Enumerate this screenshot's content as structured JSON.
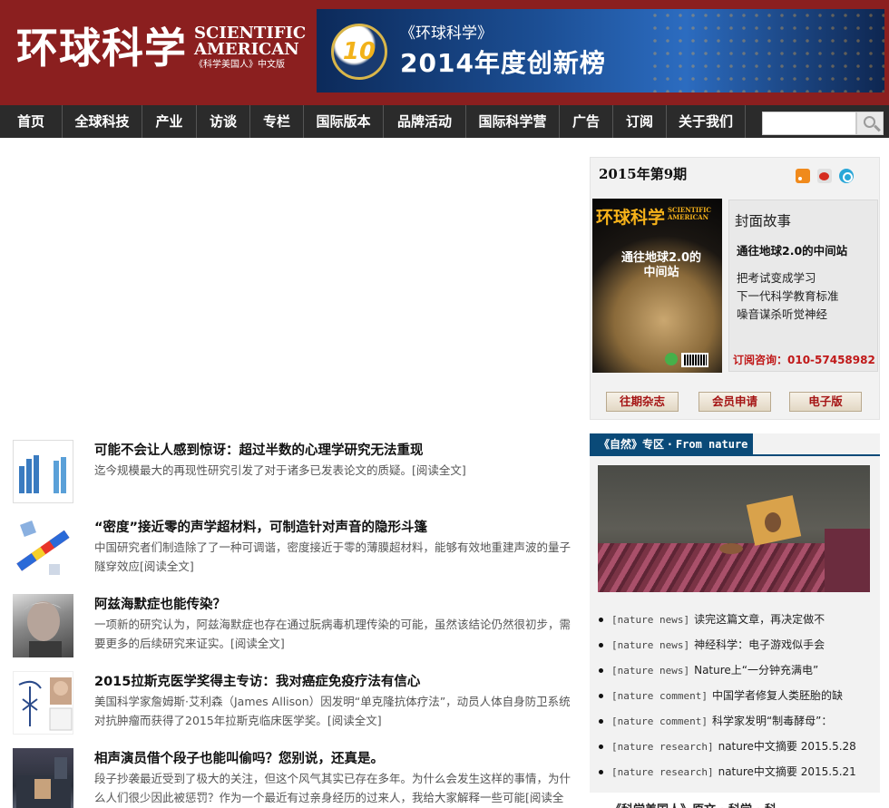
{
  "header": {
    "logo_cn": "环球科学",
    "logo_en_line1": "SCIENTIFIC",
    "logo_en_line2": "AMERICAN",
    "logo_sub": "《科学美国人》中文版",
    "banner": {
      "badge_number": "10",
      "line1": "《环球科学》",
      "line2": "2014年度创新榜"
    }
  },
  "nav": {
    "items": [
      "首页",
      "全球科技",
      "产业",
      "访谈",
      "专栏",
      "国际版本",
      "品牌活动",
      "国际科学营",
      "广告",
      "订阅",
      "关于我们"
    ],
    "search_placeholder": ""
  },
  "articles": [
    {
      "title": "可能不会让人感到惊讶：超过半数的心理学研究无法重现",
      "desc": "迄今规模最大的再现性研究引发了对于诸多已发表论文的质疑。",
      "more": "[阅读全文]"
    },
    {
      "title": "“密度”接近零的声学超材料，可制造针对声音的隐形斗篷",
      "desc": "中国研究者们制造除了了一种可调谐，密度接近于零的薄膜超材料，能够有效地重建声波的量子隧穿效应",
      "more": "[阅读全文]"
    },
    {
      "title": "阿兹海默症也能传染？",
      "desc": "一项新的研究认为，阿兹海默症也存在通过朊病毒机理传染的可能，虽然该结论仍然很初步，需要更多的后续研究来证实。",
      "more": "[阅读全文]"
    },
    {
      "title": "2015拉斯克医学奖得主专访：我对癌症免疫疗法有信心",
      "desc": "美国科学家詹姆斯·艾利森（James Allison）因发明“单克隆抗体疗法”，动员人体自身防卫系统对抗肿瘤而获得了2015年拉斯克临床医学奖。",
      "more": "[阅读全文]"
    },
    {
      "title": "相声演员借个段子也能叫偷吗？您别说，还真是。",
      "desc": "段子抄袭最近受到了极大的关注，但这个风气其实已存在多年。为什么会发生这样的事情，为什么人们很少因此被惩罚？作为一个最近有过亲身经历的过来人，我给大家解释一些可能",
      "more": "[阅读全文]"
    }
  ],
  "issue": {
    "title": "2015年第9期",
    "cover": {
      "logo_cn": "环球科学",
      "logo_en": "SCIENTIFIC AMERICAN",
      "headline": "通往地球2.0的中间站"
    },
    "story_heading": "封面故事",
    "story_main": "通往地球2.0的中间站",
    "story_links": [
      "把考试变成学习",
      "下一代科学教育标准",
      "噪音谋杀听觉神经"
    ],
    "subscribe_phone": "订阅咨询：010-57458982",
    "buttons": [
      "往期杂志",
      "会员申请",
      "电子版"
    ]
  },
  "nature": {
    "tab_cn": "《自然》专区 · ",
    "tab_en": "From nature",
    "news": [
      {
        "tag": "[nature news]",
        "text": "读完这篇文章，再决定做不"
      },
      {
        "tag": "[nature news]",
        "text": "神经科学：电子游戏似手会"
      },
      {
        "tag": "[nature news]",
        "text": "Nature上“一分钟充满电”"
      },
      {
        "tag": "[nature comment]",
        "text": "中国学者修复人类胚胎的缺"
      },
      {
        "tag": "[nature comment]",
        "text": "科学家发明“制毒酵母”："
      },
      {
        "tag": "[nature research]",
        "text": "nature中文摘要 2015.5.28"
      },
      {
        "tag": "[nature research]",
        "text": "nature中文摘要 2015.5.21"
      }
    ]
  },
  "bottom_tab": "《科学美国人》原文 · 科学 · 科"
}
